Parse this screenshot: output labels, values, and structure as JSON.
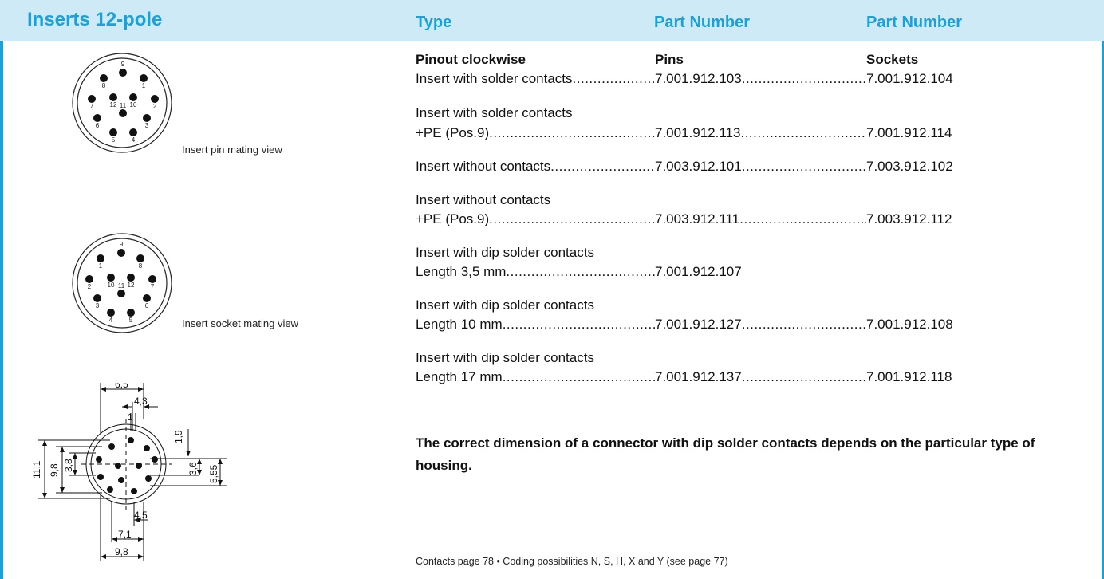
{
  "header": {
    "title": "Inserts 12-pole",
    "col_type": "Type",
    "col_pn_pins": "Part Number",
    "col_pn_sockets": "Part Number"
  },
  "column_labels": {
    "type": "Pinout clockwise",
    "pins": "Pins",
    "sockets": "Sockets"
  },
  "diagrams": {
    "pin_view_caption": "Insert pin mating view",
    "pin_view_numbers": [
      "1",
      "2",
      "3",
      "4",
      "5",
      "6",
      "7",
      "8",
      "9",
      "10",
      "11",
      "12"
    ],
    "socket_view_caption": "Insert socket mating view",
    "socket_view_numbers": [
      "1",
      "2",
      "3",
      "4",
      "5",
      "6",
      "7",
      "8",
      "9",
      "10",
      "11",
      "12"
    ],
    "dimensions": {
      "d_6_5": "6,5",
      "d_4_3": "4,3",
      "d_1": "1",
      "d_1_9": "1,9",
      "d_11_1": "11,1",
      "d_9_8_left": "9,8",
      "d_3_8": "3,8",
      "d_3_6": "3,6",
      "d_5_55": "5,55",
      "d_4_5": "4,5",
      "d_7_1": "7,1",
      "d_9_8_bottom": "9,8"
    }
  },
  "items": [
    {
      "lines": [
        "Insert with solder contacts"
      ],
      "pins": "7.001.912.103",
      "sockets": "7.001.912.104"
    },
    {
      "lines": [
        "Insert with solder contacts",
        "+PE (Pos.9)"
      ],
      "pins": "7.001.912.113",
      "sockets": "7.001.912.114"
    },
    {
      "lines": [
        "Insert without contacts"
      ],
      "pins": "7.003.912.101",
      "sockets": "7.003.912.102"
    },
    {
      "lines": [
        "Insert without contacts",
        "+PE (Pos.9)"
      ],
      "pins": "7.003.912.111",
      "sockets": "7.003.912.112"
    },
    {
      "lines": [
        "Insert with dip solder contacts",
        "Length 3,5 mm"
      ],
      "pins": "7.001.912.107",
      "sockets": ""
    },
    {
      "lines": [
        "Insert with dip solder contacts",
        "Length 10 mm"
      ],
      "pins": "7.001.912.127",
      "sockets": "7.001.912.108"
    },
    {
      "lines": [
        "Insert with dip solder contacts",
        "Length 17 mm"
      ],
      "pins": "7.001.912.137",
      "sockets": "7.001.912.118"
    }
  ],
  "note": "The correct dimension of a connector with dip solder contacts depends on the particular type of housing.",
  "footer": "Contacts page 78 • Coding possibilities N, S, H, X and Y (see page 77)",
  "colors": {
    "accent": "#1aa2d8",
    "header_bg": "#cfeaf7"
  }
}
